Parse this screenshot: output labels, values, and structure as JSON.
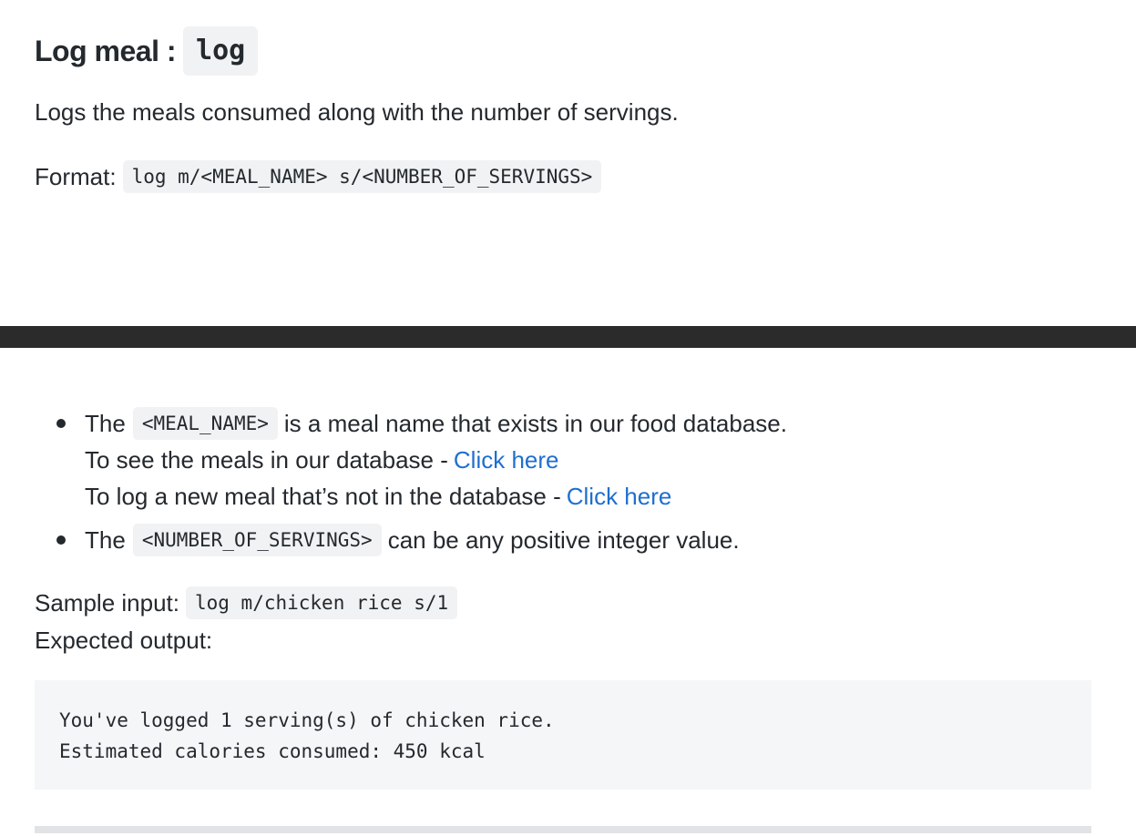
{
  "section": {
    "title": "Log meal :",
    "command": "log",
    "description": "Logs the meals consumed along with the number of servings.",
    "format_label": "Format:",
    "format_code": "log m/<MEAL_NAME> s/<NUMBER_OF_SERVINGS>"
  },
  "notes": {
    "item1": {
      "prefix": "The",
      "code": "<MEAL_NAME>",
      "suffix": "is a meal name that exists in our food database.",
      "line2_text": "To see the meals in our database -",
      "line2_link": "Click here",
      "line3_text": "To log a new meal that’s not in the database -",
      "line3_link": "Click here"
    },
    "item2": {
      "prefix": "The",
      "code": "<NUMBER_OF_SERVINGS>",
      "suffix": "can be any positive integer value."
    }
  },
  "example": {
    "sample_label": "Sample input:",
    "sample_code": "log m/chicken rice s/1",
    "expected_label": "Expected output:",
    "output_lines": [
      "You've logged 1 serving(s) of chicken rice.",
      "Estimated calories consumed: 450 kcal"
    ]
  },
  "colors": {
    "link": "#1f6fd0",
    "divider": "#2b2b2b",
    "code_bg": "#f1f2f3",
    "output_bg": "#f5f6f8"
  }
}
